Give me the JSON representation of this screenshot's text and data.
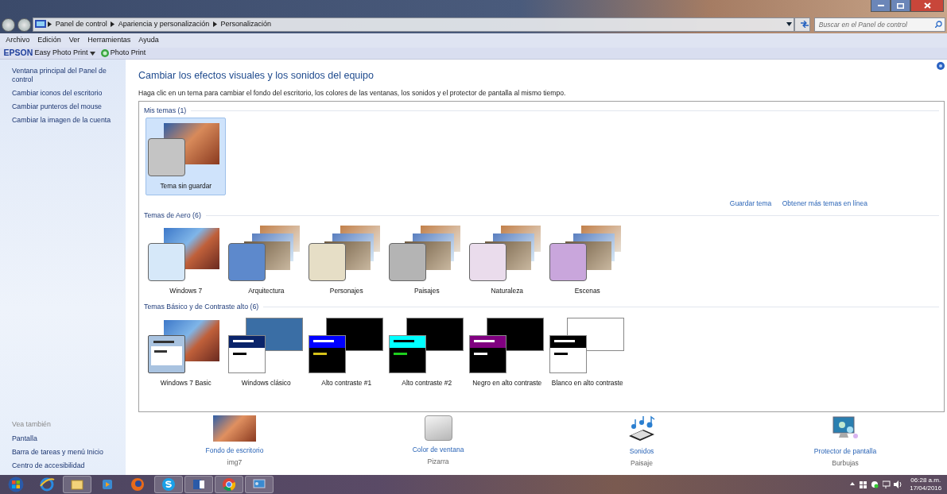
{
  "window": {
    "breadcrumb": [
      "Panel de control",
      "Apariencia y personalización",
      "Personalización"
    ],
    "search": {
      "placeholder": "Buscar en el Panel de control"
    }
  },
  "menu": [
    "Archivo",
    "Edición",
    "Ver",
    "Herramientas",
    "Ayuda"
  ],
  "toolbar": {
    "brand": "EPSON",
    "app": "Easy Photo Print",
    "action": "Photo Print"
  },
  "sidebar": {
    "links": [
      "Ventana principal del Panel de control",
      "Cambiar iconos del escritorio",
      "Cambiar punteros del mouse",
      "Cambiar la imagen de la cuenta"
    ],
    "see_also_title": "Vea también",
    "see_also": [
      "Pantalla",
      "Barra de tareas y menú Inicio",
      "Centro de accesibilidad"
    ]
  },
  "heading": "Cambiar los efectos visuales y los sonidos del equipo",
  "description": "Haga clic en un tema para cambiar el fondo del escritorio, los colores de las ventanas, los sonidos y el protector de pantalla al mismo tiempo.",
  "theme_groups": [
    {
      "title": "Mis temas (1)",
      "links": [
        "Guardar tema",
        "Obtener más temas en línea"
      ],
      "themes": [
        {
          "name": "Tema sin guardar",
          "kind": "photo",
          "color": "#c4c4c4",
          "selected": true
        }
      ]
    },
    {
      "title": "Temas de Aero (6)",
      "themes": [
        {
          "name": "Windows 7",
          "kind": "photo",
          "color": "#d6e8f9",
          "selected": false
        },
        {
          "name": "Arquitectura",
          "kind": "stack",
          "color": "#5d89cc",
          "selected": false
        },
        {
          "name": "Personajes",
          "kind": "stack",
          "color": "#e6dec6",
          "selected": false
        },
        {
          "name": "Paisajes",
          "kind": "stack",
          "color": "#b4b4b4",
          "selected": false
        },
        {
          "name": "Naturaleza",
          "kind": "stack",
          "color": "#eadcec",
          "selected": false
        },
        {
          "name": "Escenas",
          "kind": "stack",
          "color": "#c9a6dc",
          "selected": false
        }
      ]
    },
    {
      "title": "Temas Básico y de Contraste alto (6)",
      "themes": [
        {
          "name": "Windows 7 Basic",
          "kind": "basic",
          "color": "#a9c3e0",
          "selected": false
        },
        {
          "name": "Windows clásico",
          "kind": "classic",
          "color": "#0a246a",
          "selected": false
        },
        {
          "name": "Alto contraste #1",
          "kind": "contrast",
          "color": "#0000ff",
          "selected": false
        },
        {
          "name": "Alto contraste #2",
          "kind": "contrast",
          "color": "#00ffff",
          "selected": false
        },
        {
          "name": "Negro en alto contraste",
          "kind": "contrast",
          "color": "#800080",
          "selected": false
        },
        {
          "name": "Blanco en alto contraste",
          "kind": "contrast-light",
          "color": "#000000",
          "selected": false
        }
      ]
    }
  ],
  "settings": [
    {
      "kind": "background",
      "title": "Fondo de escritorio",
      "value": "img7"
    },
    {
      "kind": "color",
      "title": "Color de ventana",
      "value": "Pizarra"
    },
    {
      "kind": "sounds",
      "title": "Sonidos",
      "value": "Paisaje"
    },
    {
      "kind": "screensaver",
      "title": "Protector de pantalla",
      "value": "Burbujas"
    }
  ],
  "taskbar": {
    "time": "06:28 a.m.",
    "date": "17/04/2016"
  }
}
